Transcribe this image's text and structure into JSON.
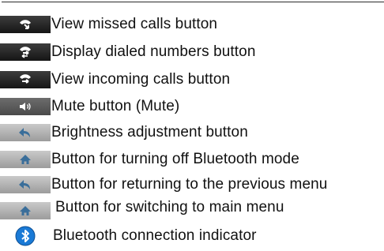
{
  "items": [
    {
      "icon": "missed-call-icon",
      "label": "View missed calls button"
    },
    {
      "icon": "dialed-call-icon",
      "label": "Display dialed numbers button"
    },
    {
      "icon": "incoming-call-icon",
      "label": "View incoming calls button"
    },
    {
      "icon": "speaker-mute-icon",
      "label": "Mute button (Mute)"
    },
    {
      "icon": "back-arrow-icon",
      "label": "Brightness adjustment button"
    },
    {
      "icon": "home-icon",
      "label": "Button for turning off Bluetooth mode"
    },
    {
      "icon": "back-arrow-icon",
      "label": "Button for returning to the previous menu"
    },
    {
      "icon": "home-icon",
      "label": "Button for switching to main menu"
    },
    {
      "icon": "bluetooth-icon",
      "label": "Bluetooth connection indicator"
    }
  ],
  "colors": {
    "call_icon_bg": "#1f1f1f",
    "call_icon_fg": "#ffffff",
    "bluetooth_blue": "#1a7ad6"
  }
}
